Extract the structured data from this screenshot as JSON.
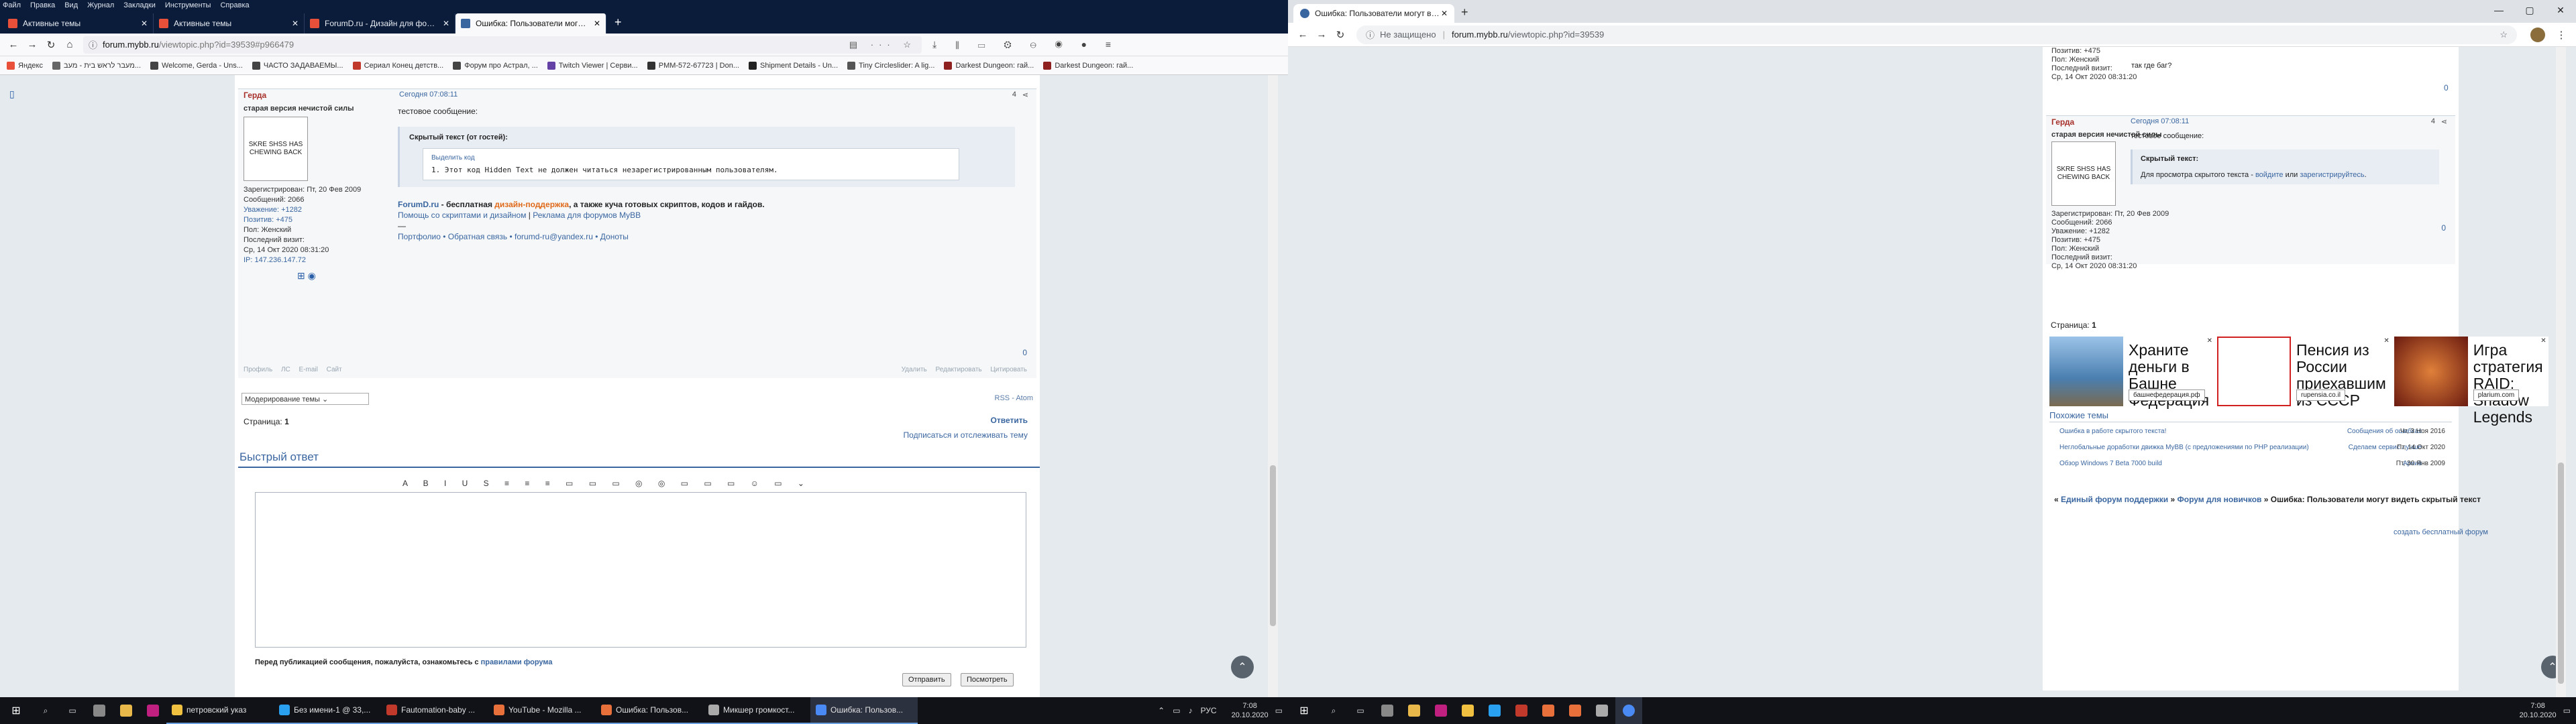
{
  "left": {
    "menu": [
      "Файл",
      "Правка",
      "Вид",
      "Журнал",
      "Закладки",
      "Инструменты",
      "Справка"
    ],
    "tabs": [
      {
        "title": "Активные темы",
        "color": "#e8503a",
        "active": false
      },
      {
        "title": "Активные темы",
        "color": "#e8503a",
        "active": false
      },
      {
        "title": "ForumD.ru - Дизайн для фору...",
        "color": "#e8503a",
        "active": false
      },
      {
        "title": "Ошибка: Пользователи могут ...",
        "color": "#3a66a0",
        "active": true
      }
    ],
    "url_host": "forum.mybb.ru",
    "url_path": "/viewtopic.php?id=39539#p966479",
    "bookmarks": [
      {
        "label": "Яндекс",
        "color": "#e8503a"
      },
      {
        "label": "מעבר לראש בית - מעב...",
        "color": "#666666"
      },
      {
        "label": "Welcome, Gerda - Uns...",
        "color": "#444444"
      },
      {
        "label": "ЧАСТО ЗАДАВАЕМЫ...",
        "color": "#444444"
      },
      {
        "label": "Сериал Конец детств...",
        "color": "#c0392b"
      },
      {
        "label": "Форум про Астрал, ...",
        "color": "#444444"
      },
      {
        "label": "Twitch Viewer | Серви...",
        "color": "#6441a5"
      },
      {
        "label": "PMM-572-67723 | Don...",
        "color": "#333333"
      },
      {
        "label": "Shipment Details - Un...",
        "color": "#222222"
      },
      {
        "label": "Tiny Circleslider: A lig...",
        "color": "#555555"
      },
      {
        "label": "Darkest Dungeon: гай...",
        "color": "#8e2020"
      },
      {
        "label": "Darkest Dungeon: гай...",
        "color": "#8e2020"
      }
    ],
    "post": {
      "author": "Герда",
      "time": "Сегодня 07:08:11",
      "num": "4",
      "rank": "старая версия нечистой силы",
      "avatar_text": "SKRE SHSS HAS CHEWING BACK",
      "info": [
        "Зарегистрирован: Пт, 20 Фев 2009",
        "Сообщений: 2066",
        "Уважение: +1282",
        "Позитив: +475",
        "Пол: Женский",
        "Последний визит:",
        "Ср, 14 Окт 2020 08:31:20",
        "IP: 147.236.147.72"
      ],
      "message": "тестовое сообщение:",
      "hidden_title": "Скрытый текст (от гостей):",
      "select_code": "Выделить код",
      "code_line": "1. Этот код Hidden Text не должен читаться незарегистрированным пользователям.",
      "sig_brand": "ForumD.ru",
      "sig_text1": " - бесплатная ",
      "sig_orange": "дизайн-поддержка",
      "sig_text2": ", а также куча готовых скриптов, кодов и гайдов.",
      "sig_line2a": "Помощь со скриптами и дизайном",
      "sig_line2b": " | ",
      "sig_line2c": "Реклама для форумов MyBB",
      "sig_sep": "—",
      "sig_line4": "Портфолио • Обратная связь • forumd-ru@yandex.ru • Доноты",
      "rating": "0",
      "foot_left": "Профиль ЛС E-mail Сайт",
      "foot_right": "Удалить Редактировать Цитировать"
    },
    "moderation_select": "Модерирование темы",
    "rss": "RSS - Atom",
    "pages_label": "Страница:",
    "pages_value": "1",
    "reply": "Ответить",
    "subscribe": "Подписаться и отслеживать тему",
    "quick_reply": "Быстрый ответ",
    "toolbar": "A B I U S ≡ ≡ ≡ ▭ ▭ ▭ ◎ ◎ ▭ ▭ ▭ ☺ ▭ ⌄",
    "rules_text": "Перед публикацией сообщения, пожалуйста, ознакомьтесь с ",
    "rules_link": "правилами форума",
    "send": "Отправить",
    "preview": "Посмотреть",
    "taskbar_apps": [
      {
        "label": "петровский указ",
        "color": "#f0c040",
        "active": false
      },
      {
        "label": "Без имени-1 @ 33,...",
        "color": "#2aa0f0",
        "active": false
      },
      {
        "label": "Fautomation-baby ...",
        "color": "#c0392b",
        "active": false
      },
      {
        "label": "YouTube - Mozilla ...",
        "color": "#e8703a",
        "active": false
      },
      {
        "label": "Ошибка: Пользов...",
        "color": "#e8703a",
        "active": false
      },
      {
        "label": "Микшер громкост...",
        "color": "#aaaaaa",
        "active": false
      },
      {
        "label": "Ошибка: Пользов...",
        "color": "#4a8af4",
        "active": true
      }
    ],
    "tray_lang": "РУС",
    "time": "7:08",
    "date": "20.10.2020"
  },
  "right": {
    "tab_title": "Ошибка: Пользователи могут ви...",
    "not_secure": "Не защищено",
    "url_host": "forum.mybb.ru",
    "url_path": "/viewtopic.php?id=39539",
    "top_info": [
      "Позитив: +475",
      "Пол: Женский",
      "Последний визит:",
      "Ср, 14 Окт 2020 08:31:20"
    ],
    "top_msg": "так где баг?",
    "top_rating": "0",
    "post": {
      "author": "Герда",
      "time": "Сегодня 07:08:11",
      "num": "4",
      "rank": "старая версия нечистой силы",
      "avatar_text": "SKRE SHSS HAS CHEWING BACK",
      "info": [
        "Зарегистрирован: Пт, 20 Фев 2009",
        "Сообщений: 2066",
        "Уважение: +1282",
        "Позитив: +475",
        "Пол: Женский",
        "Последний визит:",
        "Ср, 14 Окт 2020 08:31:20"
      ],
      "message": "тестовое сообщение:",
      "hidden_title": "Скрытый текст:",
      "hidden_a": "Для просмотра скрытого текста - ",
      "hidden_login": "войдите",
      "hidden_or": " или ",
      "hidden_register": "зарегистрируйтесь",
      "hidden_end": ".",
      "rating": "0"
    },
    "pages_label": "Страница:",
    "pages_value": "1",
    "ads": [
      {
        "text": "Храните деньги в Башне Федерация",
        "cta": "башнефедерация.рф",
        "color": "#4a7fb0"
      },
      {
        "text": "Пенсия из России приехавшим из СССР",
        "cta": "rupensia.co.il",
        "color": "#d02020"
      },
      {
        "text": "Игра стратегия RAID: Shadow Legends",
        "cta": "plarium.com",
        "color": "#8a3a20"
      }
    ],
    "similar_title": "Похожие темы",
    "similar": [
      {
        "title": "Ошибка в работе скрытого текста!",
        "section": "Сообщения об ошибках",
        "date": "Чт, 3 Ноя 2016"
      },
      {
        "title": "Неглобальные доработки движка MyBB (с предложениями по PHP реализации)",
        "section": "Сделаем сервис лучше",
        "date": "Пт, 14 Окт 2020"
      },
      {
        "title": "Обзор Windows 7 Beta 7000 build",
        "section": "Архив",
        "date": "Пт, 30 Янв 2009"
      }
    ],
    "crumb1": "Единый форум поддержки",
    "crumb2": "Форум для новичков",
    "crumb3": "Ошибка: Пользователи могут видеть скрытый текст",
    "crumb_sep": " » ",
    "crumb_lead": "« ",
    "footer": "создать бесплатный форум",
    "time": "7:08",
    "date": "20.10.2020"
  }
}
